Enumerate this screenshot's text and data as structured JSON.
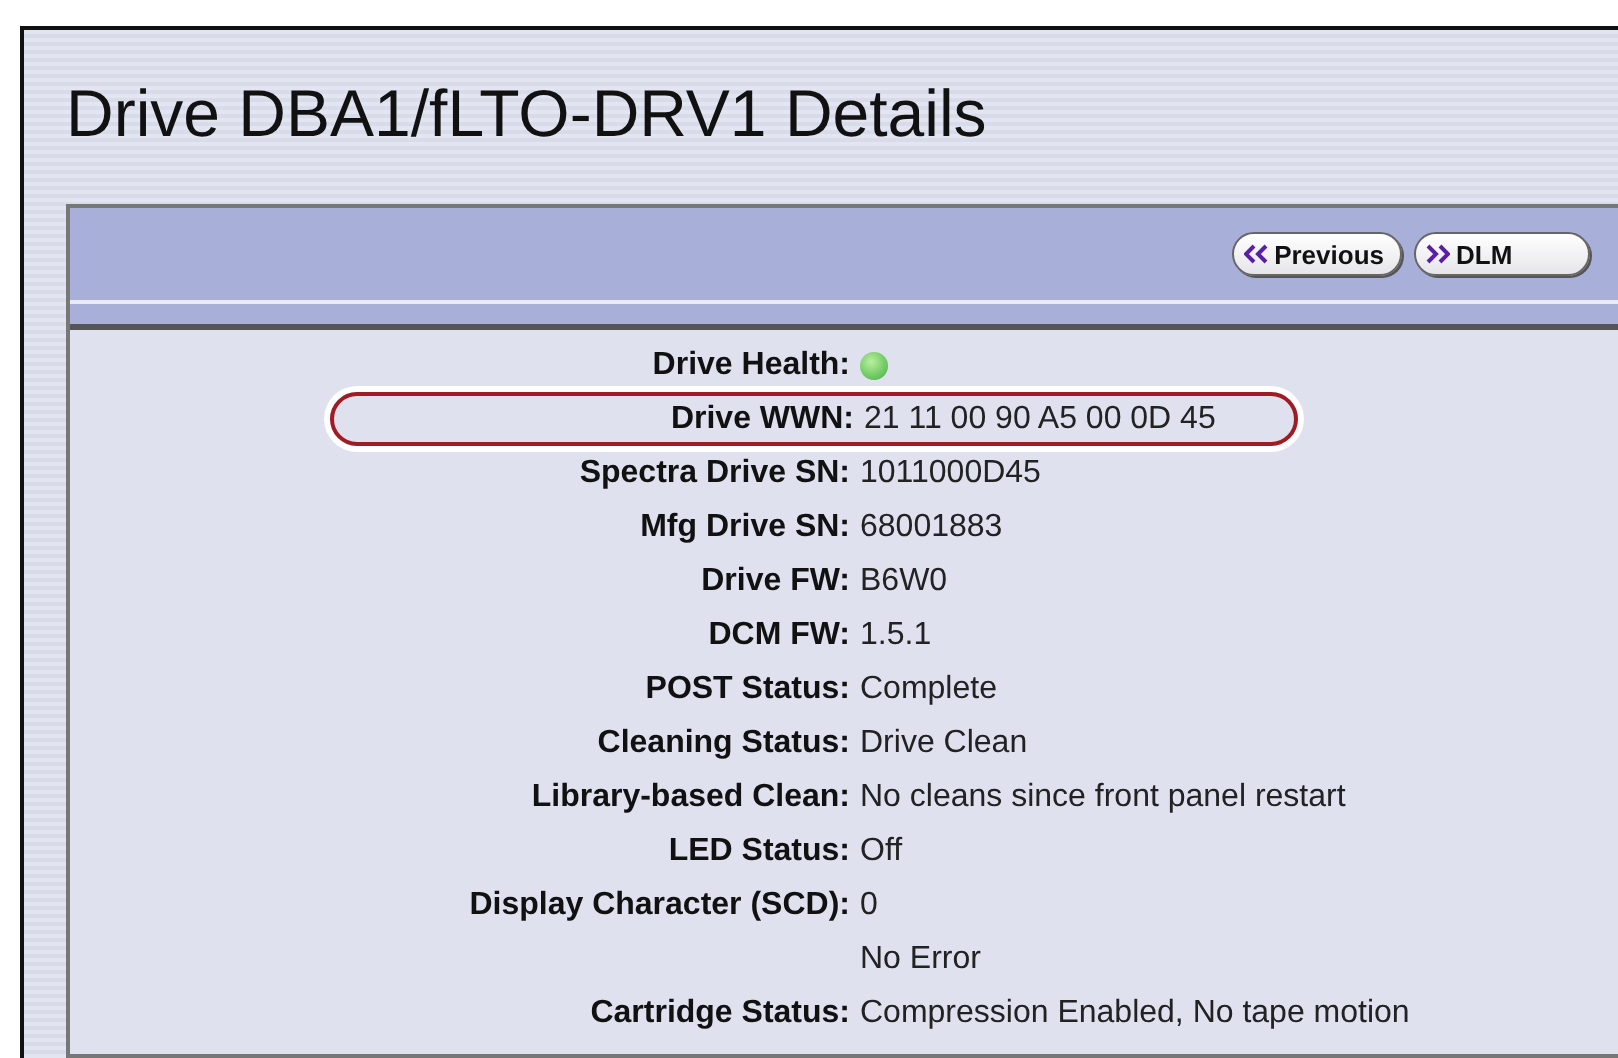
{
  "title": "Drive DBA1/fLTO-DRV1 Details",
  "buttons": [
    {
      "label": "Previous",
      "kind": "back"
    },
    {
      "label": "DLM",
      "kind": "forward"
    }
  ],
  "rows": [
    {
      "kind": "status",
      "label": "Drive Health:",
      "healthy": true,
      "highlighted": false
    },
    {
      "kind": "text",
      "label": "Drive WWN:",
      "value": "21 11 00 90 A5 00 0D 45",
      "highlighted": true
    },
    {
      "kind": "text",
      "label": "Spectra Drive SN:",
      "value": "1011000D45",
      "highlighted": false
    },
    {
      "kind": "text",
      "label": "Mfg Drive SN:",
      "value": "68001883",
      "highlighted": false
    },
    {
      "kind": "text",
      "label": "Drive FW:",
      "value": "B6W0",
      "highlighted": false
    },
    {
      "kind": "text",
      "label": "DCM FW:",
      "value": "1.5.1",
      "highlighted": false
    },
    {
      "kind": "text",
      "label": "POST Status:",
      "value": "Complete",
      "highlighted": false
    },
    {
      "kind": "text",
      "label": "Cleaning Status:",
      "value": "Drive Clean",
      "highlighted": false
    },
    {
      "kind": "text",
      "label": "Library-based Clean:",
      "value": "No cleans since front panel restart",
      "highlighted": false
    },
    {
      "kind": "text",
      "label": "LED Status:",
      "value": "Off",
      "highlighted": false
    },
    {
      "kind": "text",
      "label": "Display Character (SCD):",
      "value": "0",
      "highlighted": false
    },
    {
      "kind": "text",
      "value": "No Error",
      "highlighted": false
    },
    {
      "kind": "text",
      "label": "Cartridge Status:",
      "value": "Compression Enabled, No tape motion",
      "highlighted": false
    }
  ]
}
